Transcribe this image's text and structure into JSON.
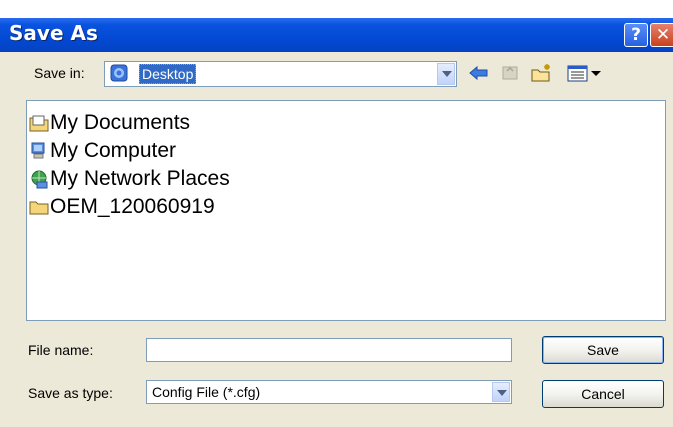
{
  "window": {
    "title": "Save As",
    "help_label": "?",
    "close_label": "✕"
  },
  "save_in": {
    "label": "Save in:",
    "value": "Desktop"
  },
  "toolbar": {
    "back_icon": "back-arrow-icon",
    "up_icon": "up-one-level-icon",
    "new_folder_icon": "new-folder-icon",
    "view_menu_icon": "view-menu-icon"
  },
  "files": [
    {
      "label": "My Documents",
      "icon": "my-documents-icon"
    },
    {
      "label": "My Computer",
      "icon": "my-computer-icon"
    },
    {
      "label": "My Network Places",
      "icon": "network-places-icon"
    },
    {
      "label": "OEM_120060919",
      "icon": "folder-icon"
    }
  ],
  "file_name": {
    "label": "File name:",
    "value": ""
  },
  "save_as_type": {
    "label": "Save as type:",
    "value": "Config File (*.cfg)"
  },
  "buttons": {
    "save": "Save",
    "cancel": "Cancel"
  },
  "colors": {
    "title_bar": "#0349d3",
    "dialog_bg": "#ece9d8",
    "selection": "#316ac5"
  }
}
